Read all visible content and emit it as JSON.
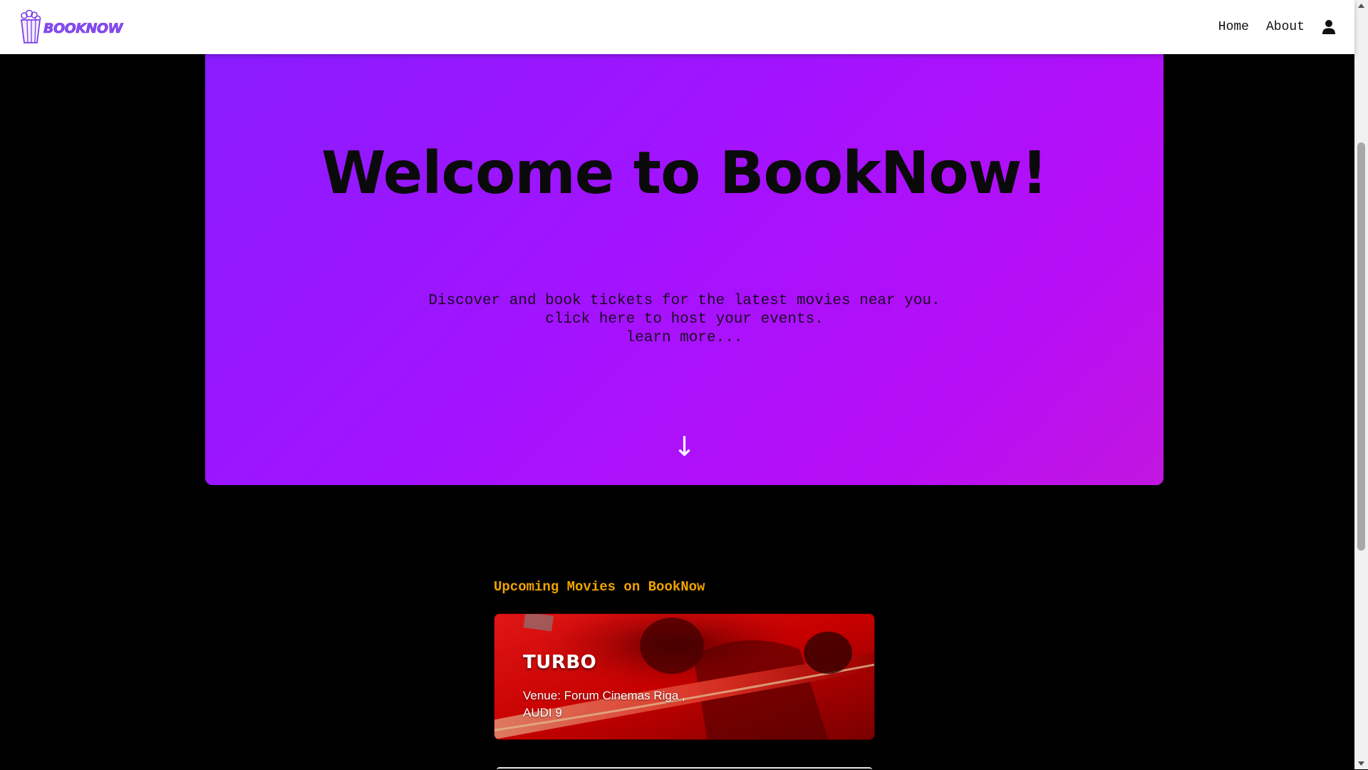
{
  "navbar": {
    "logo_text": "BOOKNOW",
    "links": [
      {
        "label": "Home"
      },
      {
        "label": "About"
      }
    ],
    "user_icon": "user-icon"
  },
  "hero": {
    "title": "Welcome to BookNow!",
    "lines": [
      "Discover and book tickets for the latest movies near you.",
      "click here to host your events.",
      "learn more..."
    ],
    "arrow": "↓"
  },
  "upcoming": {
    "heading": "Upcoming Movies on BookNow",
    "movies": [
      {
        "title": "TURBO",
        "venue": "Venue: Forum Cinemas Riga , AUDI 9"
      }
    ]
  },
  "colors": {
    "accent": "#a313ff",
    "heading": "#f0a300",
    "logo": "#8a4cf5",
    "background": "#000000"
  }
}
